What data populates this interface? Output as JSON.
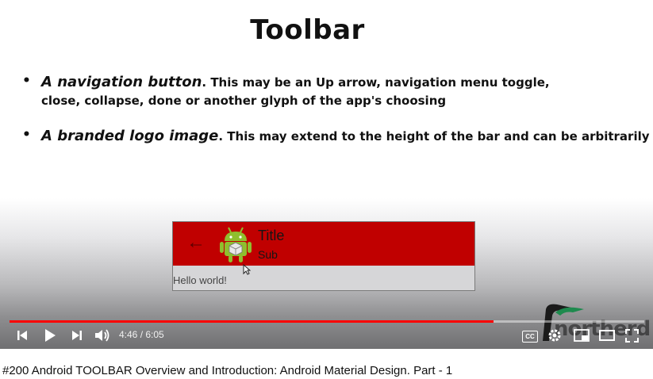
{
  "slide": {
    "title": "Toolbar",
    "bullet1": {
      "emphasis": "A navigation button",
      "rest": ". This may be an Up arrow, navigation menu toggle,",
      "line2": "close, collapse, done or another glyph of the app's choosing"
    },
    "bullet2": {
      "emphasis": "A branded logo image",
      "rest": ". This may extend to the height of the bar and can be arbitrarily wide."
    },
    "bullet_symbol": "•"
  },
  "demo": {
    "nav_icon": "arrow-back-icon",
    "nav_glyph": "←",
    "logo_icon": "android-logo-icon",
    "title": "Title",
    "subtitle": "Sub",
    "body_text": "Hello world!",
    "toolbar_color": "#c00000"
  },
  "watermark": {
    "text": "northerd"
  },
  "player": {
    "progress": 0.7625,
    "time_current": "4:46",
    "time_separator": " / ",
    "time_total": "6:05",
    "progress_color": "#ff0000",
    "controls_left": [
      "skip-previous-icon",
      "play-icon",
      "skip-next-icon",
      "volume-icon"
    ],
    "controls_right": [
      "cc-icon",
      "settings-icon",
      "miniplayer-icon",
      "theater-icon",
      "fullscreen-icon"
    ],
    "cc_label": "CC"
  },
  "video_title": "#200 Android TOOLBAR Overview and Introduction: Android Material Design. Part - 1"
}
